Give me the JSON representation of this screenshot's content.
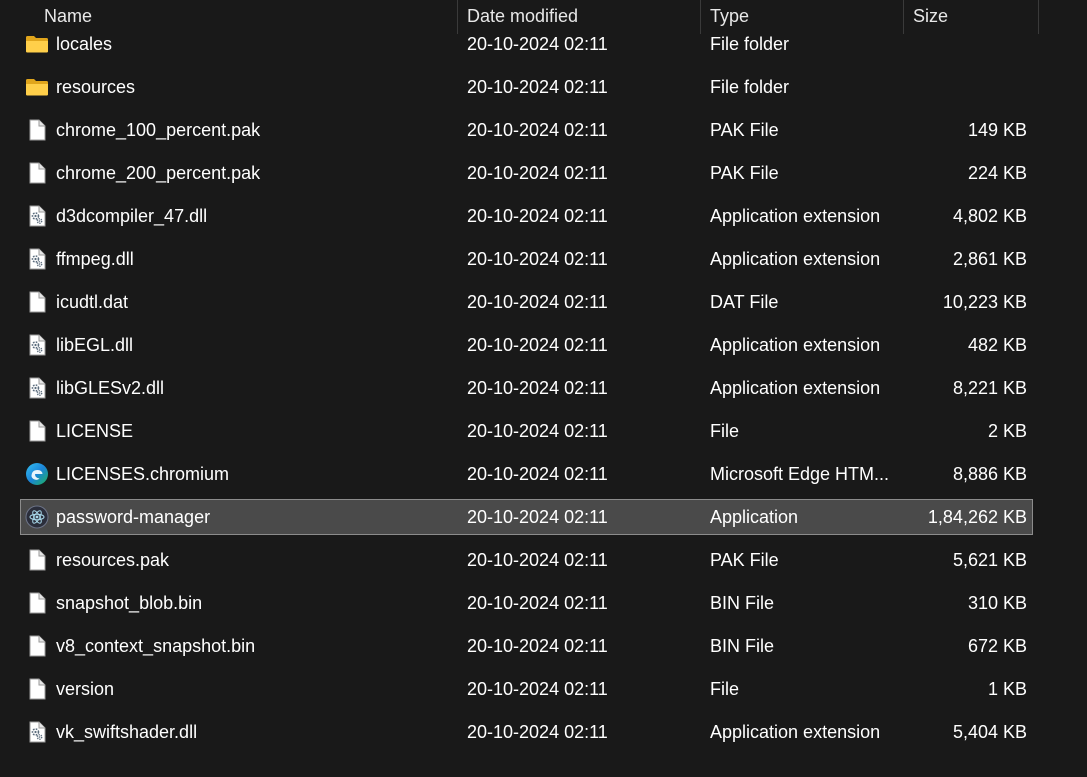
{
  "columns": {
    "name": "Name",
    "date_modified": "Date modified",
    "type": "Type",
    "size": "Size"
  },
  "files": [
    {
      "name": "locales",
      "date": "20-10-2024 02:11",
      "type": "File folder",
      "size": "",
      "icon": "folder-icon"
    },
    {
      "name": "resources",
      "date": "20-10-2024 02:11",
      "type": "File folder",
      "size": "",
      "icon": "folder-icon"
    },
    {
      "name": "chrome_100_percent.pak",
      "date": "20-10-2024 02:11",
      "type": "PAK File",
      "size": "149 KB",
      "icon": "file-icon"
    },
    {
      "name": "chrome_200_percent.pak",
      "date": "20-10-2024 02:11",
      "type": "PAK File",
      "size": "224 KB",
      "icon": "file-icon"
    },
    {
      "name": "d3dcompiler_47.dll",
      "date": "20-10-2024 02:11",
      "type": "Application extension",
      "size": "4,802 KB",
      "icon": "dll-icon"
    },
    {
      "name": "ffmpeg.dll",
      "date": "20-10-2024 02:11",
      "type": "Application extension",
      "size": "2,861 KB",
      "icon": "dll-icon"
    },
    {
      "name": "icudtl.dat",
      "date": "20-10-2024 02:11",
      "type": "DAT File",
      "size": "10,223 KB",
      "icon": "file-icon"
    },
    {
      "name": "libEGL.dll",
      "date": "20-10-2024 02:11",
      "type": "Application extension",
      "size": "482 KB",
      "icon": "dll-icon"
    },
    {
      "name": "libGLESv2.dll",
      "date": "20-10-2024 02:11",
      "type": "Application extension",
      "size": "8,221 KB",
      "icon": "dll-icon"
    },
    {
      "name": "LICENSE",
      "date": "20-10-2024 02:11",
      "type": "File",
      "size": "2 KB",
      "icon": "file-icon"
    },
    {
      "name": "LICENSES.chromium",
      "date": "20-10-2024 02:11",
      "type": "Microsoft Edge HTM...",
      "size": "8,886 KB",
      "icon": "edge-icon"
    },
    {
      "name": "password-manager",
      "date": "20-10-2024 02:11",
      "type": "Application",
      "size": "1,84,262 KB",
      "icon": "electron-app-icon",
      "selected": true
    },
    {
      "name": "resources.pak",
      "date": "20-10-2024 02:11",
      "type": "PAK File",
      "size": "5,621 KB",
      "icon": "file-icon"
    },
    {
      "name": "snapshot_blob.bin",
      "date": "20-10-2024 02:11",
      "type": "BIN File",
      "size": "310 KB",
      "icon": "file-icon"
    },
    {
      "name": "v8_context_snapshot.bin",
      "date": "20-10-2024 02:11",
      "type": "BIN File",
      "size": "672 KB",
      "icon": "file-icon"
    },
    {
      "name": "version",
      "date": "20-10-2024 02:11",
      "type": "File",
      "size": "1 KB",
      "icon": "file-icon"
    },
    {
      "name": "vk_swiftshader.dll",
      "date": "20-10-2024 02:11",
      "type": "Application extension",
      "size": "5,404 KB",
      "icon": "dll-icon"
    }
  ]
}
